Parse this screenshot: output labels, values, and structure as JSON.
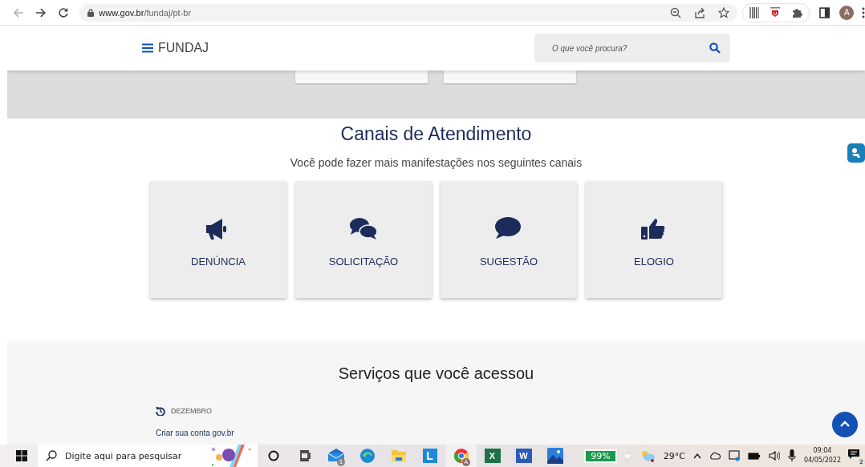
{
  "browser": {
    "url_host": "www.gov.br",
    "url_path": "/fundaj/pt-br",
    "profile_initial": "A"
  },
  "header": {
    "logo": "FUNDAJ",
    "search": {
      "placeholder": "O que você procura?"
    }
  },
  "channels_section": {
    "title": "Canais de Atendimento",
    "subtitle": "Você pode fazer mais manifestações nos seguintes canais",
    "cards": [
      {
        "kind": "megaphone",
        "label": "DENÚNCIA"
      },
      {
        "kind": "chat",
        "label": "SOLICITAÇÃO"
      },
      {
        "kind": "bubble",
        "label": "SUGESTÃO"
      },
      {
        "kind": "thumbs",
        "label": "ELOGIO"
      }
    ]
  },
  "services_section": {
    "title": "Serviços que você acessou",
    "groups": [
      {
        "label": "DEZEMBRO",
        "links": [
          "Criar sua conta gov.br"
        ]
      }
    ]
  },
  "taskbar": {
    "search": {
      "placeholder": "Digite aqui para pesquisar"
    },
    "apps": [
      {
        "kind": "cortana"
      },
      {
        "kind": "taskview"
      },
      {
        "kind": "mail",
        "badge": "1"
      },
      {
        "kind": "edge"
      },
      {
        "kind": "explorer"
      },
      {
        "kind": "lapp",
        "label": "L"
      },
      {
        "kind": "chrome",
        "badge": "A"
      },
      {
        "kind": "excel",
        "label": "X"
      },
      {
        "kind": "word",
        "label": "W"
      },
      {
        "kind": "photos"
      }
    ],
    "battery": "99%",
    "temperature": "29°C",
    "time": "09:04",
    "date": "04/05/2022",
    "notifications": "2"
  }
}
